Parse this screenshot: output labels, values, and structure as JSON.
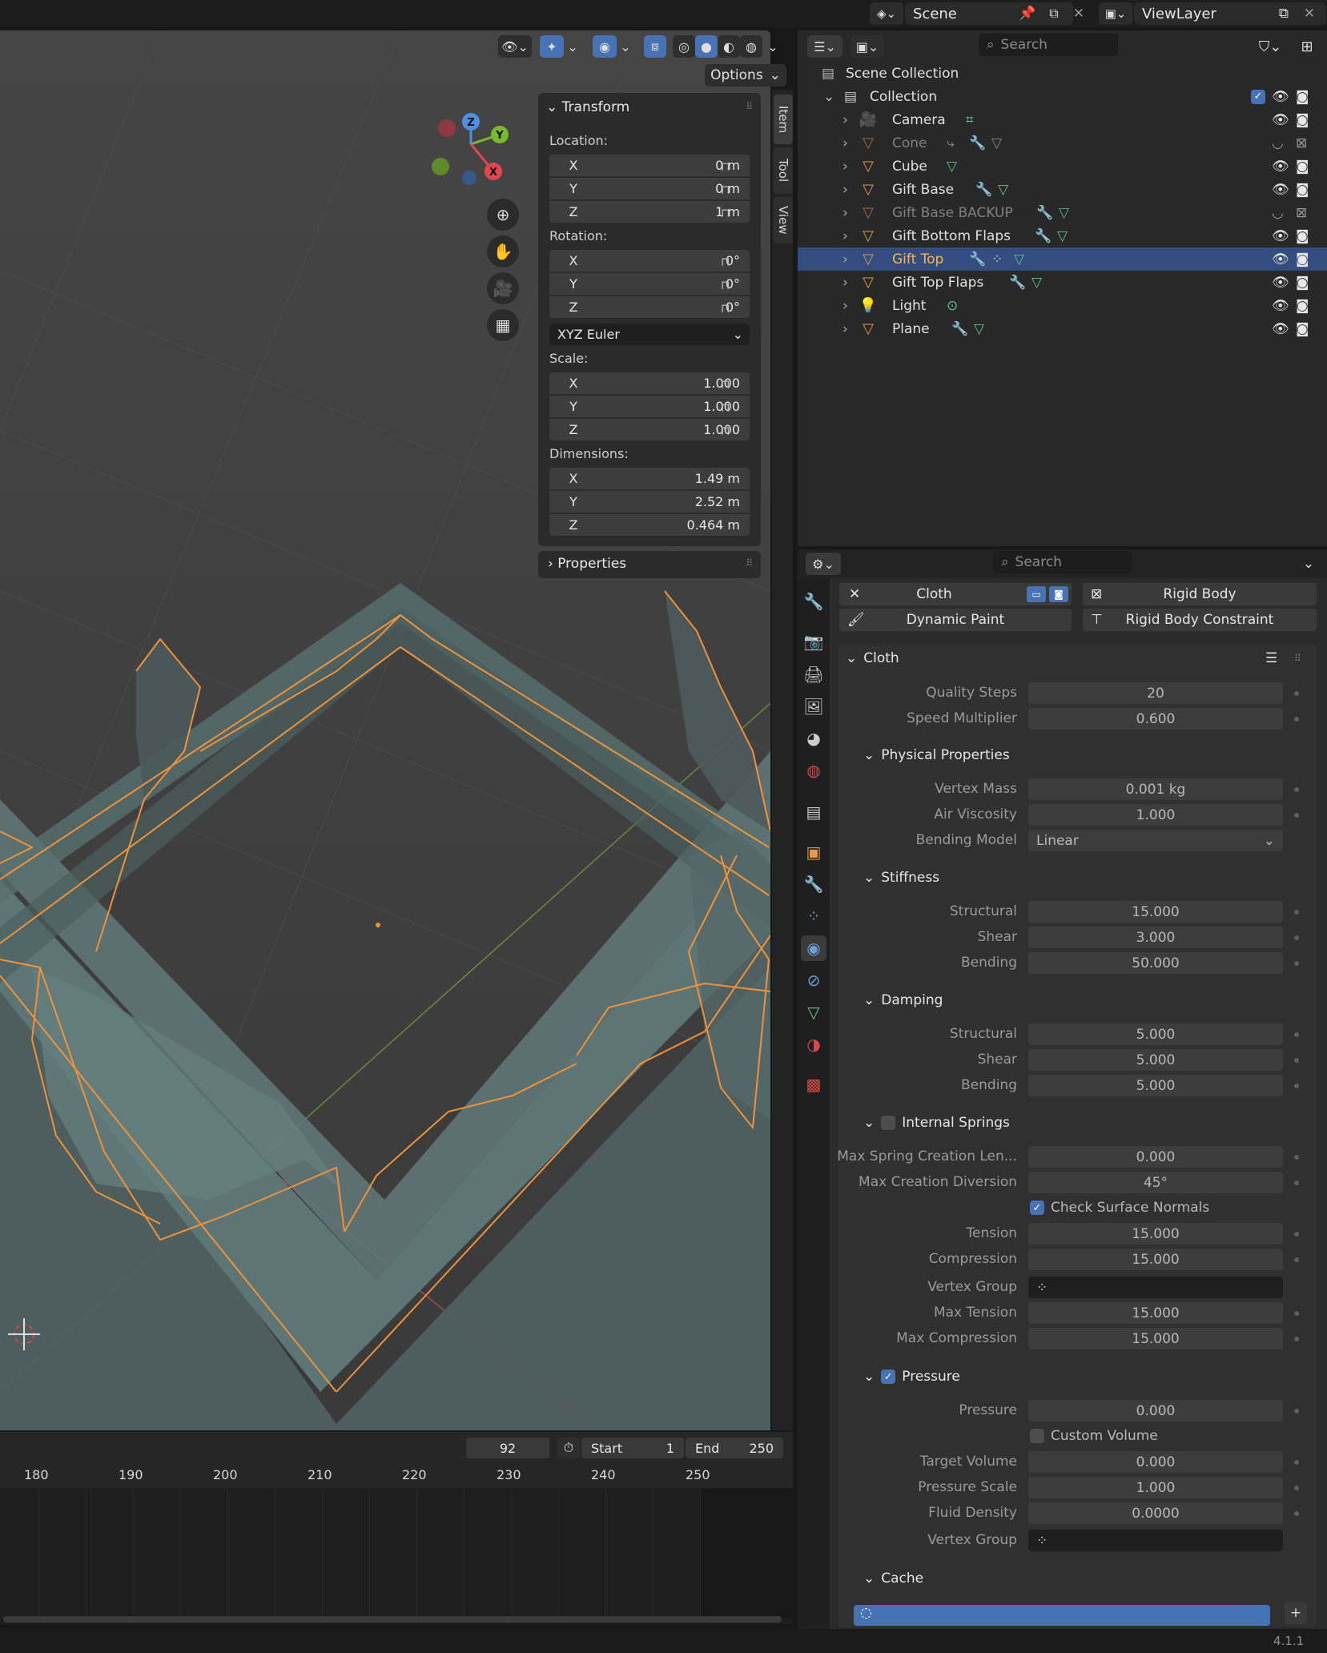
{
  "topbar": {
    "scene_label": "Scene",
    "viewlayer_label": "ViewLayer"
  },
  "viewport": {
    "options_label": "Options",
    "n_panel": {
      "transform_title": "Transform",
      "location_label": "Location:",
      "location": [
        {
          "axis": "X",
          "value": "0 m"
        },
        {
          "axis": "Y",
          "value": "0 m"
        },
        {
          "axis": "Z",
          "value": "1 m"
        }
      ],
      "rotation_label": "Rotation:",
      "rotation": [
        {
          "axis": "X",
          "value": "0°"
        },
        {
          "axis": "Y",
          "value": "0°"
        },
        {
          "axis": "Z",
          "value": "0°"
        }
      ],
      "rotation_mode": "XYZ Euler",
      "scale_label": "Scale:",
      "scale": [
        {
          "axis": "X",
          "value": "1.000"
        },
        {
          "axis": "Y",
          "value": "1.000"
        },
        {
          "axis": "Z",
          "value": "1.000"
        }
      ],
      "dimensions_label": "Dimensions:",
      "dimensions": [
        {
          "axis": "X",
          "value": "1.49 m"
        },
        {
          "axis": "Y",
          "value": "2.52 m"
        },
        {
          "axis": "Z",
          "value": "0.464 m"
        }
      ],
      "properties_title": "Properties"
    },
    "side_tabs": [
      "Item",
      "Tool",
      "View"
    ],
    "gizmo": {
      "x": "X",
      "y": "Y",
      "z": "Z"
    }
  },
  "timeline": {
    "current_frame": "92",
    "start_label": "Start",
    "start_value": "1",
    "end_label": "End",
    "end_value": "250",
    "ticks": [
      "180",
      "190",
      "200",
      "210",
      "220",
      "230",
      "240",
      "250"
    ]
  },
  "outliner": {
    "search_placeholder": "Search",
    "scene_collection": "Scene Collection",
    "collection": "Collection",
    "items": [
      {
        "name": "Camera",
        "icon": "camera-icon",
        "dim": false,
        "selected": false
      },
      {
        "name": "Cone",
        "icon": "mesh-icon",
        "dim": true,
        "selected": false
      },
      {
        "name": "Cube",
        "icon": "mesh-icon",
        "dim": false,
        "selected": false
      },
      {
        "name": "Gift Base",
        "icon": "mesh-icon",
        "dim": false,
        "selected": false
      },
      {
        "name": "Gift Base BACKUP",
        "icon": "mesh-icon",
        "dim": true,
        "selected": false
      },
      {
        "name": "Gift Bottom Flaps",
        "icon": "mesh-icon",
        "dim": false,
        "selected": false
      },
      {
        "name": "Gift Top",
        "icon": "mesh-icon",
        "dim": false,
        "selected": true
      },
      {
        "name": "Gift Top Flaps",
        "icon": "mesh-icon",
        "dim": false,
        "selected": false
      },
      {
        "name": "Light",
        "icon": "light-icon",
        "dim": false,
        "selected": false
      },
      {
        "name": "Plane",
        "icon": "mesh-icon",
        "dim": false,
        "selected": false
      }
    ]
  },
  "properties": {
    "search_placeholder": "Search",
    "physics_buttons": {
      "cloth": "Cloth",
      "rigid_body": "Rigid Body",
      "dynamic_paint": "Dynamic Paint",
      "rigid_body_constraint": "Rigid Body Constraint"
    },
    "cloth": {
      "title": "Cloth",
      "quality_steps_label": "Quality Steps",
      "quality_steps": "20",
      "speed_multiplier_label": "Speed Multiplier",
      "speed_multiplier": "0.600",
      "physical_title": "Physical Properties",
      "vertex_mass_label": "Vertex Mass",
      "vertex_mass": "0.001 kg",
      "air_viscosity_label": "Air Viscosity",
      "air_viscosity": "1.000",
      "bending_model_label": "Bending Model",
      "bending_model": "Linear",
      "stiffness_title": "Stiffness",
      "stiff_structural_label": "Structural",
      "stiff_structural": "15.000",
      "stiff_shear_label": "Shear",
      "stiff_shear": "3.000",
      "stiff_bending_label": "Bending",
      "stiff_bending": "50.000",
      "damping_title": "Damping",
      "damp_structural_label": "Structural",
      "damp_structural": "5.000",
      "damp_shear_label": "Shear",
      "damp_shear": "5.000",
      "damp_bending_label": "Bending",
      "damp_bending": "5.000",
      "internal_title": "Internal Springs",
      "max_spring_label": "Max Spring Creation Len...",
      "max_spring": "0.000",
      "max_diversion_label": "Max Creation Diversion",
      "max_diversion": "45°",
      "check_normals_label": "Check Surface Normals",
      "tension_label": "Tension",
      "tension": "15.000",
      "compression_label": "Compression",
      "compression": "15.000",
      "vertex_group_label": "Vertex Group",
      "max_tension_label": "Max Tension",
      "max_tension": "15.000",
      "max_compression_label": "Max Compression",
      "max_compression": "15.000",
      "pressure_title": "Pressure",
      "pressure_label": "Pressure",
      "pressure": "0.000",
      "custom_volume_label": "Custom Volume",
      "target_volume_label": "Target Volume",
      "target_volume": "0.000",
      "pressure_scale_label": "Pressure Scale",
      "pressure_scale": "1.000",
      "fluid_density_label": "Fluid Density",
      "fluid_density": "0.0000",
      "vertex_group2_label": "Vertex Group",
      "cache_title": "Cache"
    }
  },
  "version": "4.1.1",
  "colors": {
    "accent": "#4772b3",
    "selection": "#334d80",
    "object_orange": "#e59a4e",
    "modifier_blue": "#6a9ed8",
    "data_green": "#5fc48a"
  }
}
